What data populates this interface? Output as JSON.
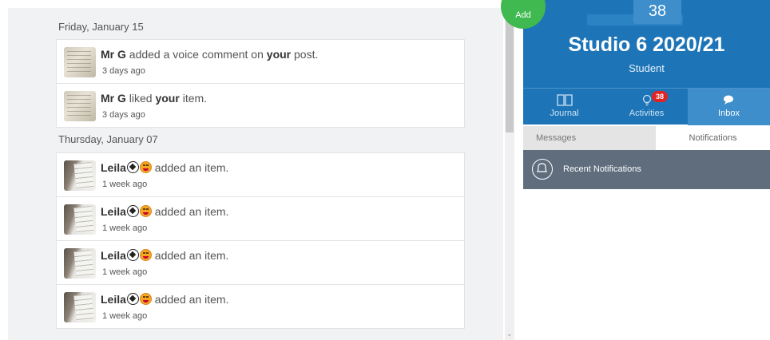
{
  "feed": {
    "groups": [
      {
        "date": "Friday, January 15",
        "items": [
          {
            "author": "Mr G",
            "pre": " added a voice comment on ",
            "strong": "your",
            "post": " post.",
            "time": "3 days ago"
          },
          {
            "author": "Mr G",
            "pre": " liked ",
            "strong": "your",
            "post": " item.",
            "time": "3 days ago"
          }
        ]
      },
      {
        "date": "Thursday, January 07",
        "items": [
          {
            "author": "Leila",
            "action": " added an item.",
            "time": "1 week ago"
          },
          {
            "author": "Leila",
            "action": " added an item.",
            "time": "1 week ago"
          },
          {
            "author": "Leila",
            "action": " added an item.",
            "time": "1 week ago"
          },
          {
            "author": "Leila",
            "action": " added an item.",
            "time": "1 week ago"
          }
        ]
      }
    ]
  },
  "header": {
    "count": "38",
    "class_title": "Studio 6 2020/21",
    "role": "Student"
  },
  "nav": {
    "journal": "Journal",
    "activities": "Activities",
    "activities_badge": "38",
    "inbox": "Inbox"
  },
  "inbox": {
    "messages_tab": "Messages",
    "notifications_tab": "Notifications",
    "recent_label": "Recent Notifications"
  },
  "fab": {
    "label": "Add"
  },
  "colors": {
    "brand_blue": "#1d75b8",
    "fab_green": "#3fb950",
    "badge_red": "#e02424"
  }
}
